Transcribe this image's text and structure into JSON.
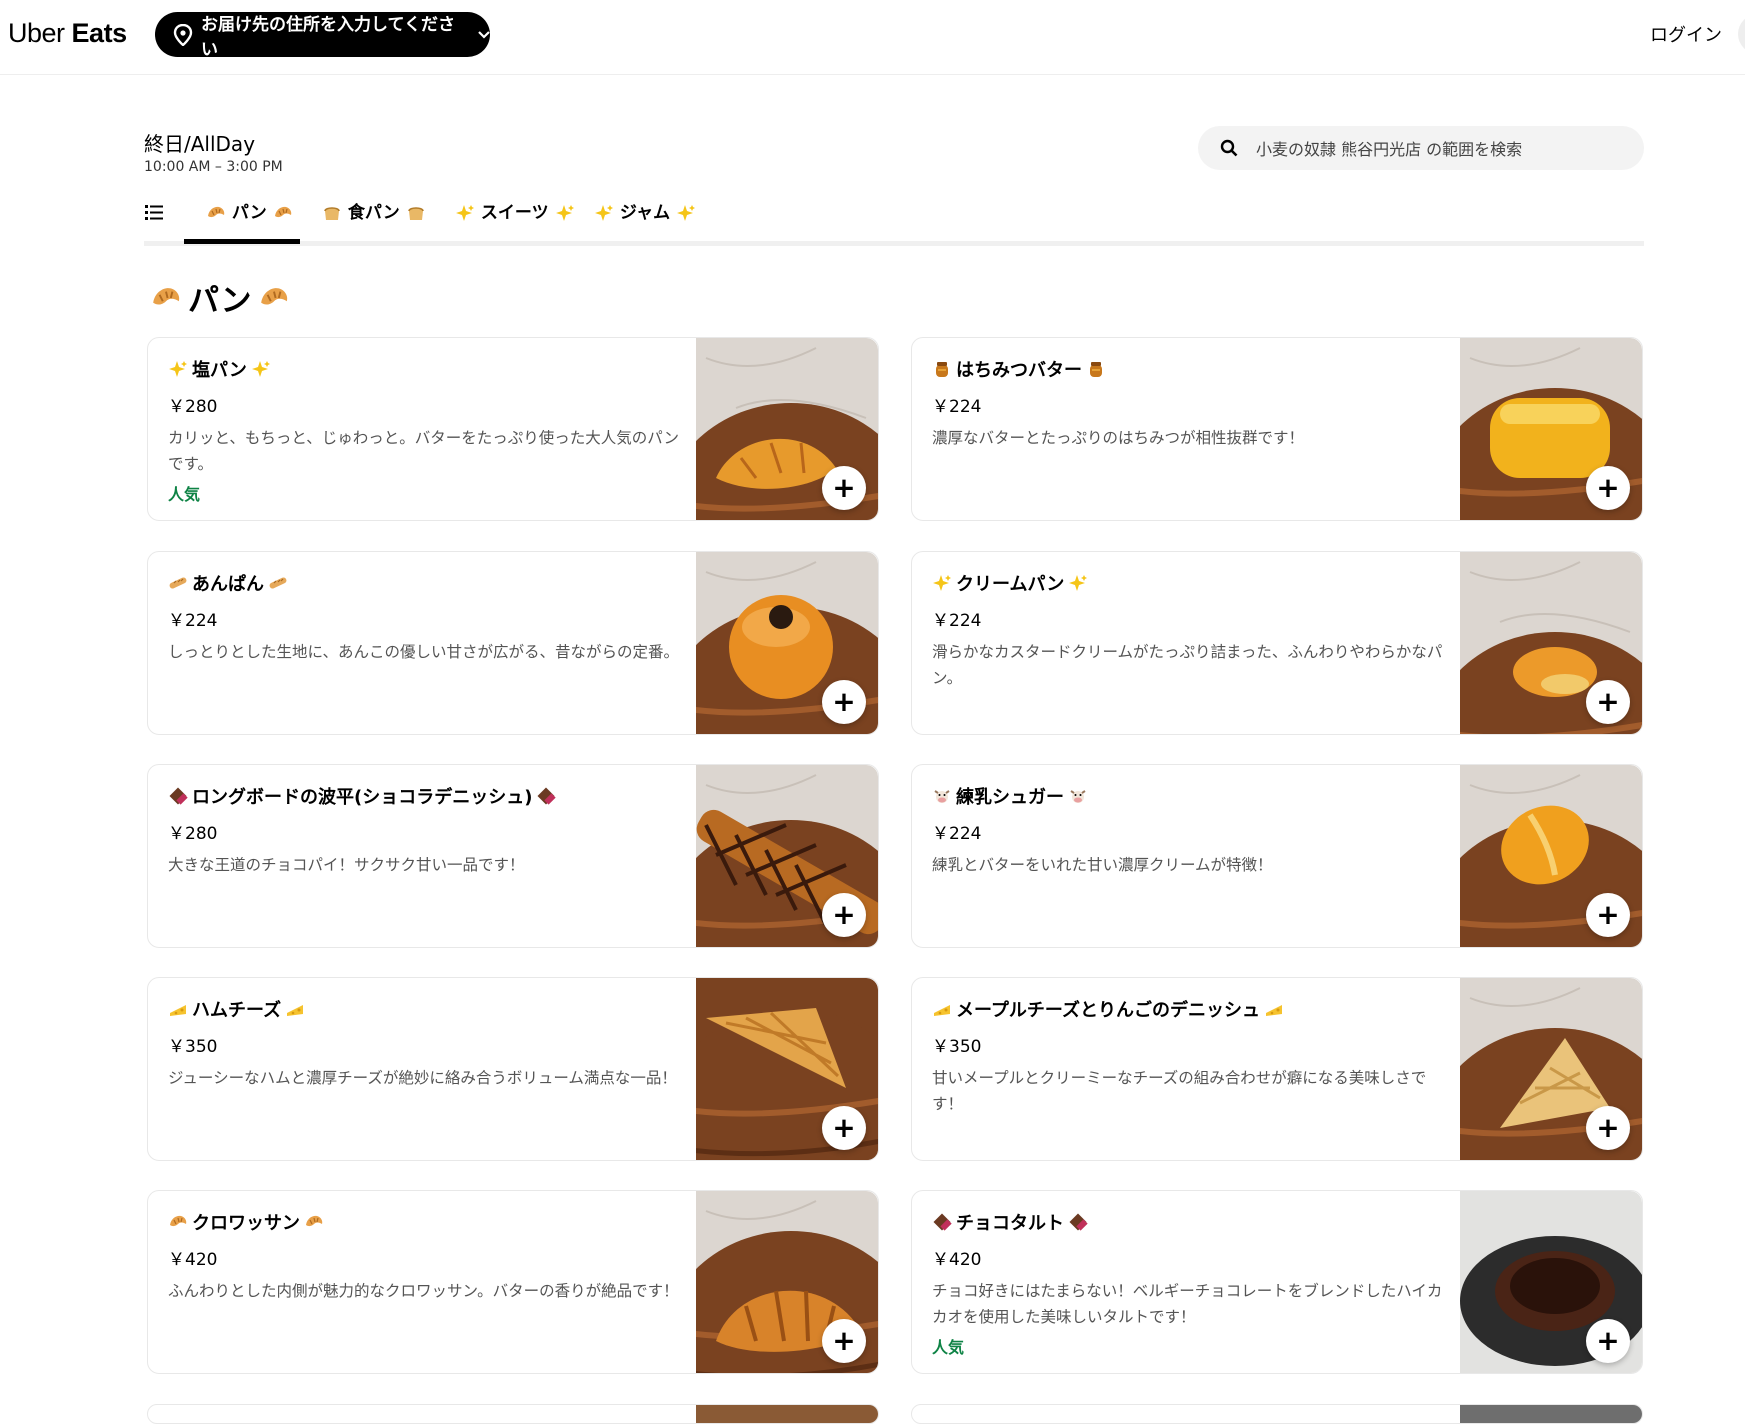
{
  "header": {
    "logo_left": "Uber",
    "logo_right": "Eats",
    "address_button": "お届け先の住所を入力してください",
    "login": "ログイン"
  },
  "store": {
    "title": "終日/AllDay",
    "hours": "10:00 AM – 3:00 PM",
    "search_placeholder": "小麦の奴隷 熊谷円光店 の範囲を検索"
  },
  "tabs": [
    {
      "label": "パン",
      "emoji": "croissant-icon",
      "active": true
    },
    {
      "label": "食パン",
      "emoji": "bread-icon",
      "active": false
    },
    {
      "label": "スイーツ",
      "emoji": "sparkles-icon",
      "active": false
    },
    {
      "label": "ジャム",
      "emoji": "sparkles-icon",
      "active": false
    }
  ],
  "section": {
    "title": "パン",
    "emoji": "croissant-icon"
  },
  "items": [
    {
      "name": "塩パン",
      "emoji": "sparkles-icon",
      "price": "￥280",
      "desc": "カリッと、もちっと、じゅわっと。バターをたっぷり使った大人気のパンです。",
      "badge": "人気",
      "photo": "shio-pan"
    },
    {
      "name": "はちみつバター",
      "emoji": "honey-pot-icon",
      "price": "￥224",
      "desc": "濃厚なバターとたっぷりのはちみつが相性抜群です！",
      "badge": "",
      "photo": "honey-butter"
    },
    {
      "name": "あんぱん",
      "emoji": "baguette-icon",
      "price": "￥224",
      "desc": "しっとりとした生地に、あんこの優しい甘さが広がる、昔ながらの定番。",
      "badge": "",
      "photo": "anpan"
    },
    {
      "name": "クリームパン",
      "emoji": "sparkles-icon",
      "price": "￥224",
      "desc": "滑らかなカスタードクリームがたっぷり詰まった、ふんわりやわらかなパン。",
      "badge": "",
      "photo": "cream-pan"
    },
    {
      "name": "ロングボードの波平(ショコラデニッシュ)",
      "emoji": "chocolate-icon",
      "price": "￥280",
      "desc": "大きな王道のチョコパイ！サクサク甘い一品です！",
      "badge": "",
      "photo": "choco-danish"
    },
    {
      "name": "練乳シュガー",
      "emoji": "cow-icon",
      "price": "￥224",
      "desc": "練乳とバターをいれた甘い濃厚クリームが特徴！",
      "badge": "",
      "photo": "condensed-milk"
    },
    {
      "name": "ハムチーズ",
      "emoji": "cheese-icon",
      "price": "￥350",
      "desc": "ジューシーなハムと濃厚チーズが絶妙に絡み合うボリューム満点な一品！",
      "badge": "",
      "photo": "ham-cheese"
    },
    {
      "name": "メープルチーズとりんごのデニッシュ",
      "emoji": "cheese-icon",
      "price": "￥350",
      "desc": "甘いメープルとクリーミーなチーズの組み合わせが癖になる美味しさです！",
      "badge": "",
      "photo": "maple-danish"
    },
    {
      "name": "クロワッサン",
      "emoji": "croissant-icon",
      "price": "￥420",
      "desc": "ふんわりとした内側が魅力的なクロワッサン。バターの香りが絶品です！",
      "badge": "",
      "photo": "croissant"
    },
    {
      "name": "チョコタルト",
      "emoji": "chocolate-icon",
      "price": "￥420",
      "desc": "チョコ好きにはたまらない！ベルギーチョコレートをブレンドしたハイカカオを使用した美味しいタルトです！",
      "badge": "人気",
      "photo": "choco-tart"
    }
  ],
  "colors": {
    "accent_black": "#000000",
    "badge_green": "#0e8345",
    "muted_text": "#545454"
  }
}
